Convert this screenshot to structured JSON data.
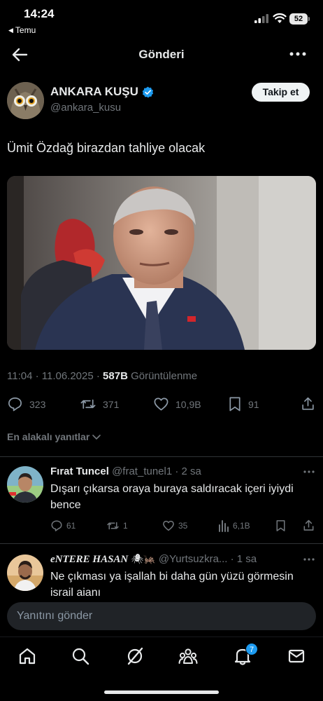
{
  "status": {
    "time": "14:24",
    "back_app": "Temu",
    "battery": "52"
  },
  "header": {
    "title": "Gönderi"
  },
  "tweet": {
    "author_name": "ANKARA KUŞU",
    "author_handle": "@ankara_kusu",
    "follow_label": "Takip et",
    "text": "Ümit Özdağ birazdan tahliye olacak",
    "time": "11:04 · 11.06.2025 · ",
    "views_count": "587B",
    "views_label": " Görüntülenme",
    "replies": "323",
    "retweets": "371",
    "likes": "10,9B",
    "bookmarks": "91"
  },
  "replies_section": {
    "sort_label": "En alakalı yanıtlar"
  },
  "replies": [
    {
      "name": "Fırat Tuncel",
      "meta": " @frat_tunel1 · 2 sa",
      "text": "Dışarı çıkarsa oraya buraya saldıracak içeri iyiydi bence",
      "replies": "61",
      "retweets": "1",
      "likes": "35",
      "views": "6,1B"
    },
    {
      "name": "eNTERE HASAN",
      "name_emoji": "🕷🦗",
      "meta": " @Yurtsuzkra... · 1 sa",
      "text": "Ne çıkması ya işallah bi daha gün yüzü görmesin israil ajanı"
    }
  ],
  "compose": {
    "placeholder": "Yanıtını gönder"
  },
  "tabbar": {
    "notification_count": "7"
  },
  "colors": {
    "accent": "#1d9bf0",
    "background": "#000000",
    "muted": "#71767b"
  }
}
